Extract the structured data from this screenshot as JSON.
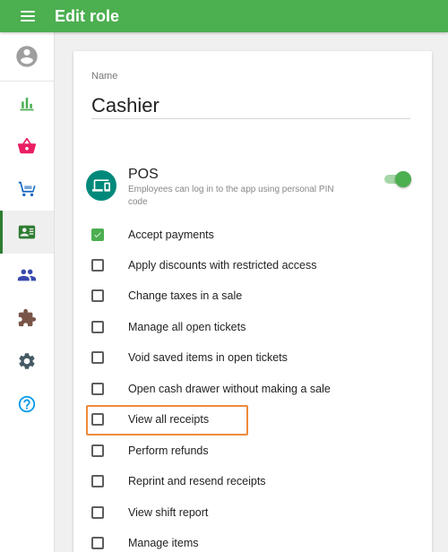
{
  "header": {
    "title": "Edit role"
  },
  "sidebar": {
    "items": [
      {
        "icon": "account-circle-icon",
        "color": "#9e9e9e"
      },
      {
        "icon": "bar-chart-icon",
        "color": "#4caf50"
      },
      {
        "icon": "basket-icon",
        "color": "#e91e63"
      },
      {
        "icon": "shopping-cart-icon",
        "color": "#1565c0"
      },
      {
        "icon": "employee-badge-icon",
        "color": "#2e7d32",
        "active": true
      },
      {
        "icon": "people-icon",
        "color": "#3949ab"
      },
      {
        "icon": "puzzle-icon",
        "color": "#795548"
      },
      {
        "icon": "gear-icon",
        "color": "#455a64"
      },
      {
        "icon": "help-icon",
        "color": "#039be5"
      }
    ]
  },
  "form": {
    "name_label": "Name",
    "name_value": "Cashier",
    "pos": {
      "title": "POS",
      "description": "Employees can log in to the app using personal PIN code",
      "enabled": true
    },
    "permissions": [
      {
        "label": "Accept payments",
        "checked": true
      },
      {
        "label": "Apply discounts with restricted access",
        "checked": false
      },
      {
        "label": "Change taxes in a sale",
        "checked": false
      },
      {
        "label": "Manage all open tickets",
        "checked": false
      },
      {
        "label": "Void saved items in open tickets",
        "checked": false
      },
      {
        "label": "Open cash drawer without making a sale",
        "checked": false
      },
      {
        "label": "View all receipts",
        "checked": false,
        "highlighted": true
      },
      {
        "label": "Perform refunds",
        "checked": false
      },
      {
        "label": "Reprint and resend receipts",
        "checked": false
      },
      {
        "label": "View shift report",
        "checked": false
      },
      {
        "label": "Manage items",
        "checked": false
      }
    ]
  },
  "colors": {
    "primary": "#4caf50",
    "pos_icon": "#00897b",
    "highlight": "#ef8a3a"
  }
}
